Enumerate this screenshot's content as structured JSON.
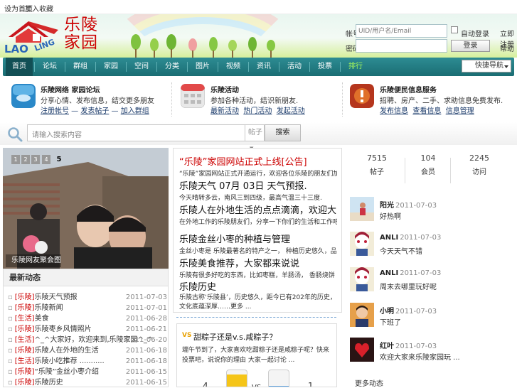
{
  "topbar": {
    "link1": "设为首页",
    "link2": "加入收藏"
  },
  "logo": {
    "en": "LAO LING",
    "cn_line1": "乐陵",
    "cn_line2": "家园"
  },
  "login": {
    "user_label": "帐号",
    "user_placeholder": "UID/用户名/Email",
    "remember_label": "自动登录",
    "register_label": "立即注册",
    "pass_label": "密码",
    "login_btn": "登录",
    "help_label": "帮助"
  },
  "nav": {
    "items": [
      "首页",
      "论坛",
      "群组",
      "家园",
      "空间",
      "分类",
      "图片",
      "视频",
      "资讯",
      "活动",
      "投票",
      "排行"
    ],
    "active_index": 0,
    "highlight_index": 11,
    "select_label": "快捷导航"
  },
  "features": [
    {
      "icon": "cloud-icon",
      "title": "乐陵网络 家园论坛",
      "desc": "分享心情、发布信息，结交更多朋友",
      "links": [
        "注册帐号",
        "发表帖子",
        "加入群组"
      ],
      "color": "#2a88c8"
    },
    {
      "icon": "calendar-icon",
      "title": "乐陵活动",
      "desc": "参加各种活动，结识新朋友.",
      "links": [
        "最新活动",
        "热门活动",
        "发起活动"
      ],
      "color": "#d44"
    },
    {
      "icon": "alert-icon",
      "title": "乐陵便民信息服务",
      "desc": "招聘、房产、二手、求助信息免费发布.",
      "links": [
        "发布信息",
        "查看信息",
        "信息管理"
      ],
      "color": "#b5361d"
    }
  ],
  "search": {
    "placeholder": "请输入搜索内容",
    "type_label": "帖子",
    "button": "搜索"
  },
  "slideshow": {
    "pages": [
      "1",
      "2",
      "3",
      "4",
      "5"
    ],
    "current": 4,
    "caption": "乐陵网友聚会图片"
  },
  "news": {
    "title": "最新动态",
    "rows": [
      {
        "cat": "[乐陵]",
        "text": "乐陵天气预报",
        "date": "2011-07-03"
      },
      {
        "cat": "[乐陵]",
        "text": "乐陵新闻",
        "date": "2011-07-01"
      },
      {
        "cat": "[生活]",
        "text": "美食",
        "date": "2011-06-28"
      },
      {
        "cat": "[乐陵]",
        "text": "乐陵枣乡风情照片",
        "date": "2011-06-21"
      },
      {
        "cat": "[生活]",
        "text": "^_^大家好，欢迎来到,乐陵家园^_^",
        "date": "2011-06-20"
      },
      {
        "cat": "[乐陵]",
        "text": "乐陵人在外地的生活",
        "date": "2011-06-18"
      },
      {
        "cat": "[生活]",
        "text": "乐陵小吃推荐 ...........",
        "date": "2011-06-18"
      },
      {
        "cat": "[乐陵]",
        "text": "“乐陵”金丝小枣介绍",
        "date": "2011-06-15"
      },
      {
        "cat": "[乐陵]",
        "text": "乐陵历史",
        "date": "2011-06-15"
      }
    ]
  },
  "center": {
    "headline": "“乐陵”家园网站正式上线[公告]",
    "headline_desc": "“乐陵”家园网站正式开通运行，欢迎各位乐陵的朋友们加入乐陵家园 一起 交流 ...",
    "items": [
      {
        "title": "乐陵天气 07月 03日 天气预报.",
        "desc": "今天晴转多云，南风三到四级，最高气温三十三度."
      },
      {
        "title": "乐陵人在外地生活的点点滴滴，欢迎大家一起分享",
        "desc": "在外地工作的乐陵朋友们，分享一下你们的生活和工作吧，大家互相帮助，共同进步，一起加油 ..."
      },
      {
        "title": "乐陵金丝小枣的种植与管理",
        "desc": "金丝小枣是 乐陵最著名的特产之一， 种植历史悠久，品质优良， 畅销全国各地 ..."
      },
      {
        "title": "乐陵美食推荐，大家都来说说",
        "desc": "乐陵有很多好吃的东西，比如枣糕，羊肠汤， 香肠烧饼 等等 ..."
      },
      {
        "title": "乐陵历史",
        "desc": "乐陵古称‘乐陵县’，历史悠久，距今已有202年的历史，文化底蕴深厚……更多 ..."
      }
    ]
  },
  "pk": {
    "vs_badge": "VS",
    "title": "甜粽子还是v.s.咸粽子？",
    "desc": "端午节到了，大家喜欢吃甜粽子还是咸粽子呢？快来投票吧，说说你的理由 大家一起讨论 ...",
    "left_count": "4",
    "vs_text": "VS",
    "right_count": "1",
    "left_ratio": 0.8,
    "right_ratio": 0.2
  },
  "stats": [
    {
      "num": "7515",
      "label": "帖子"
    },
    {
      "num": "104",
      "label": "会员"
    },
    {
      "num": "2245",
      "label": "访问"
    }
  ],
  "members": [
    {
      "name": "阳光",
      "date": "2011-07-03",
      "status": "好热啊"
    },
    {
      "name": "ANLI",
      "date": "2011-07-03",
      "status": "今天天气不错"
    },
    {
      "name": "ANLI",
      "date": "2011-07-03",
      "status": "周末去哪里玩好呢"
    },
    {
      "name": "小明",
      "date": "2011-07-03",
      "status": "下班了"
    },
    {
      "name": "红叶",
      "date": "2011-07-03",
      "status": "欢迎大家来乐陵家园玩 ..."
    }
  ],
  "right_footer": "更多动态"
}
